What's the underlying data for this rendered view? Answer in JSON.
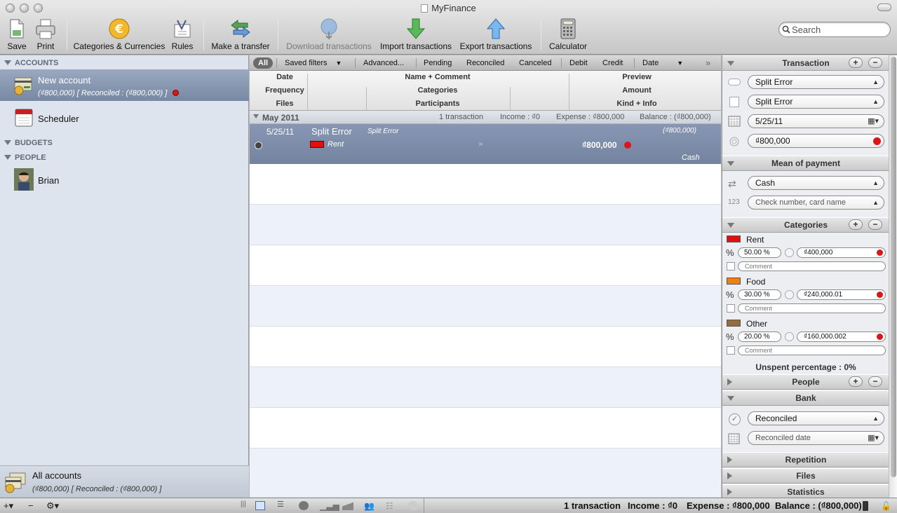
{
  "window": {
    "title": "MyFinance"
  },
  "toolbar": {
    "save": "Save",
    "print": "Print",
    "categories_currencies": "Categories & Currencies",
    "rules": "Rules",
    "make_transfer": "Make a transfer",
    "download": "Download transactions",
    "import": "Import transactions",
    "export": "Export transactions",
    "calculator": "Calculator",
    "search_placeholder": "Search"
  },
  "sidebar": {
    "accounts_header": "ACCOUNTS",
    "selected_account": {
      "name": "New account",
      "summary": "(₫800,000) [ Reconciled : (₫800,000) ]"
    },
    "scheduler": "Scheduler",
    "budgets_header": "BUDGETS",
    "people_header": "PEOPLE",
    "person": "Brian",
    "all_accounts": {
      "name": "All accounts",
      "summary": "(₫800,000) [ Reconciled : (₫800,000) ]"
    }
  },
  "filters": {
    "all": "All",
    "saved_filters": "Saved filters",
    "advanced": "Advanced...",
    "pending": "Pending",
    "reconciled": "Reconciled",
    "canceled": "Canceled",
    "debit": "Debit",
    "credit": "Credit",
    "date": "Date"
  },
  "columns": {
    "date": "Date",
    "frequency": "Frequency",
    "files": "Files",
    "name_comment": "Name + Comment",
    "categories": "Categories",
    "participants": "Participants",
    "preview": "Preview",
    "amount": "Amount",
    "kind_info": "Kind + Info"
  },
  "group": {
    "month": "May 2011",
    "count": "1 transaction",
    "income": "Income : ₫0",
    "expense": "Expense : ₫800,000",
    "balance": "Balance : (₫800,000)"
  },
  "transaction": {
    "date": "5/25/11",
    "name": "Split Error",
    "comment": "Split Error",
    "category": "Rent",
    "preview": "(₫800,000)",
    "amount": "₫800,000",
    "kind": "Cash"
  },
  "inspector": {
    "transaction_header": "Transaction",
    "name_value": "Split Error",
    "comment_value": "Split Error",
    "date_value": "5/25/11",
    "amount_value": "₫800,000",
    "payment_header": "Mean of payment",
    "payment_value": "Cash",
    "check_placeholder": "Check number, card name",
    "categories_header": "Categories",
    "categories": [
      {
        "name": "Rent",
        "color": "#e01010",
        "percent": "50.00 %",
        "amount": "₫400,000",
        "comment": "Comment"
      },
      {
        "name": "Food",
        "color": "#f08010",
        "percent": "30.00 %",
        "amount": "₫240,000.01",
        "comment": "Comment"
      },
      {
        "name": "Other",
        "color": "#9a6a3a",
        "percent": "20.00 %",
        "amount": "₫160,000.002",
        "comment": "Comment"
      }
    ],
    "unspent": "Unspent percentage : 0%",
    "people_header": "People",
    "bank_header": "Bank",
    "bank_status": "Reconciled",
    "reconciled_placeholder": "Reconciled date",
    "repetition_header": "Repetition",
    "files_header": "Files",
    "statistics_header": "Statistics"
  },
  "statusbar": {
    "count": "1 transaction",
    "income": "Income : ₫0",
    "expense": "Expense : ₫800,000",
    "balance": "Balance : (₫800,000)"
  },
  "colors": {
    "selection": "#7b8ba6",
    "sidebar": "#dde4ee",
    "expense_red": "#d81818"
  }
}
